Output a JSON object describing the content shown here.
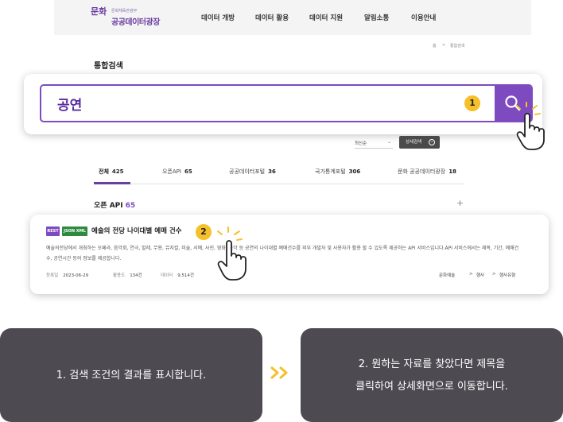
{
  "header": {
    "logo_mark": "문화",
    "logo_sub": "문화체육관광부",
    "logo_name": "공공데이터광장",
    "nav": [
      "데이터 개방",
      "데이터 활용",
      "데이터 지원",
      "알림소통",
      "이용안내"
    ]
  },
  "breadcrumb": {
    "home": "홈",
    "separator": ">",
    "current": "통합검색"
  },
  "page_title": "통합검색",
  "search": {
    "query": "공연",
    "step_badge": "1",
    "button_icon": "search-icon"
  },
  "sort": {
    "selected": "최신순",
    "detail_button": "상세검색"
  },
  "tabs": [
    {
      "label": "전체",
      "count": "425"
    },
    {
      "label": "오픈API",
      "count": "65"
    },
    {
      "label": "공공데이터포털",
      "count": "36"
    },
    {
      "label": "국가통계포털",
      "count": "306"
    },
    {
      "label": "문화 공공데이터광장",
      "count": "18"
    }
  ],
  "section": {
    "title": "오픈 API",
    "count": "65",
    "expand": "+"
  },
  "result": {
    "tags": [
      "REST",
      "JSON XML"
    ],
    "title": "예술의 전당 나이대별 예매 건수",
    "step_badge": "2",
    "description": "예술의전당에서 개최하는 오페라, 음악회, 연극, 발레, 무용, 뮤지컬, 미술, 서예, 사진, 영화, 음악 등 공연의 나이대별 예매건수를 외부 개발자 및 사용자가 활용 할 수 있도록 제공하는 API 서비스입니다.API 서비스에서는 제목, 기간, 예매건수, 공연시간 등의 정보를 제공합니다.",
    "meta": [
      {
        "label": "등록일",
        "value": "2023-06-29"
      },
      {
        "label": "활용도",
        "value": "134건"
      },
      {
        "label": "데이터",
        "value": "9,514건"
      }
    ],
    "categories": [
      "문화예술",
      "행사",
      "행사유형"
    ],
    "category_sep": ">"
  },
  "guide": {
    "step1": "1. 검색 조건의 결과를 표시합니다.",
    "step2_line1": "2. 원하는 자료를 찾았다면 제목을",
    "step2_line2": "클릭하여 상세화면으로 이동합니다."
  },
  "colors": {
    "brand_purple": "#7d4bbf",
    "badge_yellow": "#f6c02a",
    "arrow_yellow": "#f6c02a",
    "panel_bg": "#4d4a52",
    "rest_tag": "#7d4bbf",
    "json_tag": "#2e8b3e"
  }
}
